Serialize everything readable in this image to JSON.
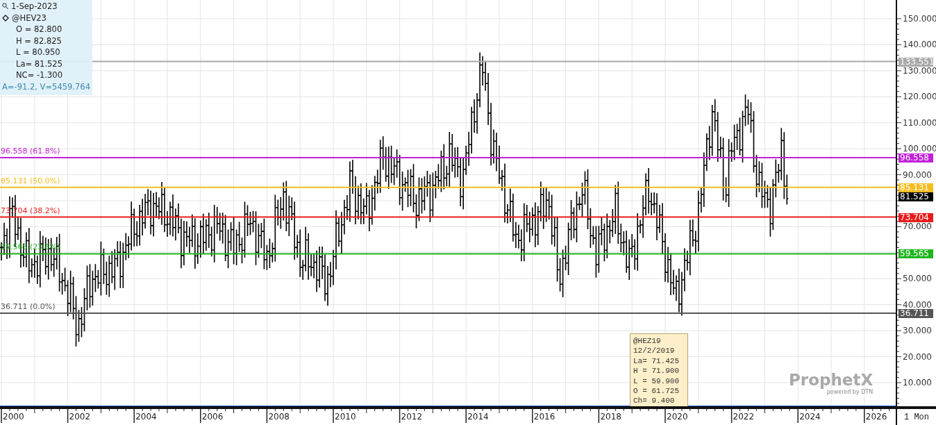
{
  "info_panel": {
    "date": "1-Sep-2023",
    "symbol": "@HEV23",
    "fields": [
      "O = 82.800",
      "H = 82.825",
      "L = 80.950",
      "La= 81.525",
      "NC= -1.300"
    ],
    "footer": "A=-91.2, V=5459.764"
  },
  "y_axis": {
    "ticks": [
      "150.000",
      "140.000",
      "130.000",
      "120.000",
      "110.000",
      "100.000",
      "90.000",
      "70.000",
      "50.000",
      "40.000",
      "30.000",
      "20.000",
      "10.000"
    ]
  },
  "levels": [
    {
      "axis_label": "133.551",
      "color": "#a8a8a8"
    },
    {
      "left_label": "96.558 (61.8%)",
      "axis_label": "96.558",
      "color": "#c21fd9"
    },
    {
      "left_label": "85.131 (50.0%)",
      "axis_label": "85.131",
      "color": "#f5bd1f"
    },
    {
      "left_label": "73.704 (38.2%)",
      "axis_label": "73.704",
      "color": "#e81c1c"
    },
    {
      "left_label": "59.565 (23.6%)",
      "axis_label": "59.565",
      "color": "#1fb51f"
    },
    {
      "left_label": "36.711 (0.0%)",
      "axis_label": "36.711",
      "color": "#555555"
    }
  ],
  "last_price": "81.525",
  "tooltip": [
    "@HEZ19",
    "12/2/2019",
    "La= 71.425",
    "H = 71.900",
    "L = 59.900",
    "O = 61.725",
    "Ch= 9.400"
  ],
  "branding": {
    "name": "ProphetX",
    "tagline": "powered by DTN"
  },
  "x_axis": {
    "ticks": [
      "2000",
      "2002",
      "2004",
      "2006",
      "2008",
      "2010",
      "2012",
      "2014",
      "2016",
      "2018",
      "2020",
      "2022",
      "2024",
      "2026"
    ]
  },
  "interval": "1 Mon"
}
